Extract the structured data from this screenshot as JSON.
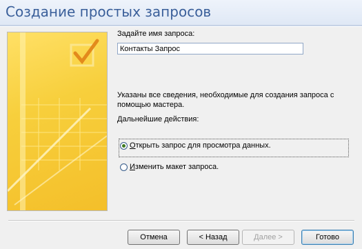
{
  "window": {
    "title": "Создание простых запросов"
  },
  "form": {
    "name_label": "Задайте имя запроса:",
    "name_value": "Контакты Запрос",
    "info_text": "Указаны все сведения, необходимые для создания запроса с помощью мастера.",
    "next_actions_label": "Дальнейшие действия:",
    "options": [
      {
        "label_underlined": "О",
        "label_rest": "ткрыть запрос для просмотра данных.",
        "checked": true
      },
      {
        "label_underlined": "И",
        "label_rest": "зменить макет запроса.",
        "checked": false
      }
    ]
  },
  "buttons": {
    "cancel": "Отмена",
    "back": "< Назад",
    "next": "Далее >",
    "finish": "Готово"
  },
  "colors": {
    "accent": "#3a5f9a",
    "panel_yellow": "#f7cf3c"
  }
}
